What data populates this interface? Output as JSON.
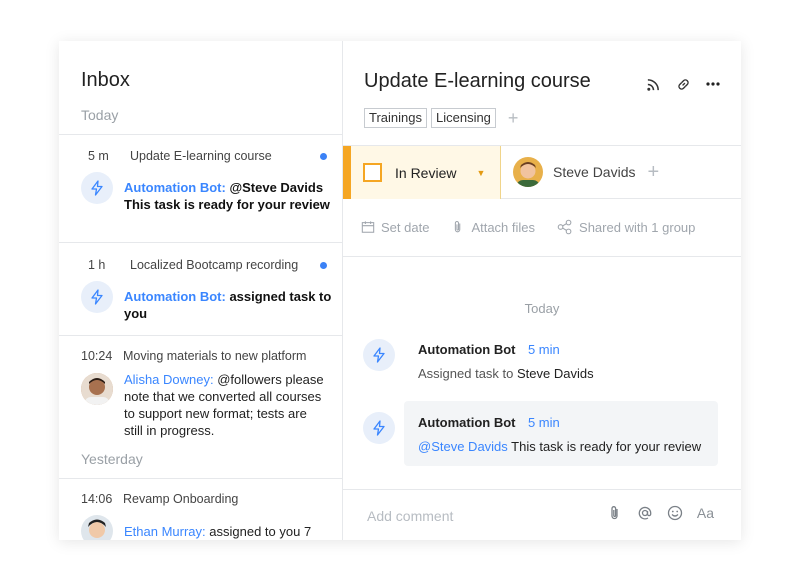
{
  "colors": {
    "accent": "#3a86ff",
    "review": "#f5a623",
    "unread_dot": "#3b82f6"
  },
  "inbox": {
    "title": "Inbox",
    "sections": {
      "today": "Today",
      "yesterday": "Yesterday"
    },
    "items": [
      {
        "time": "5 m",
        "title": "Update E-learning course",
        "author": "Automation Bot:",
        "mention": "@Steve Davids",
        "body": "This task is ready for your review",
        "icon": "bolt-icon",
        "unread": true
      },
      {
        "time": "1 h",
        "title": "Localized Bootcamp recording",
        "author": "Automation Bot:",
        "body": "assigned task to you",
        "icon": "bolt-icon",
        "unread": true
      },
      {
        "time": "10:24",
        "title": "Moving materials to new platform",
        "author": "Alisha Downey:",
        "body_line1": "@followers please",
        "body_line2": "note that we converted all courses",
        "body_line3": "to support new format; tests are",
        "body_line4": "still in progress.",
        "icon": "avatar"
      },
      {
        "time": "14:06",
        "title": "Revamp Onboarding",
        "author": "Ethan Murray:",
        "body": "assigned to you 7",
        "icon": "avatar"
      }
    ]
  },
  "detail": {
    "title": "Update E-learning course",
    "tags": [
      "Trainings",
      "Licensing"
    ],
    "tag_add": "+",
    "status": "In Review",
    "assignee": "Steve Davids",
    "assignee_add": "+",
    "actions": {
      "set_date": "Set date",
      "attach": "Attach files",
      "shared": "Shared with 1 group"
    },
    "activity_day": "Today",
    "activity": [
      {
        "name": "Automation Bot",
        "time": "5 min",
        "text_prefix": "Assigned task to",
        "text_who": "Steve Davids"
      },
      {
        "name": "Automation Bot",
        "time": "5 min",
        "mention": "@Steve Davids",
        "text": " This task is ready for your review"
      }
    ],
    "comment_placeholder": "Add comment",
    "format_label": "Aa"
  }
}
